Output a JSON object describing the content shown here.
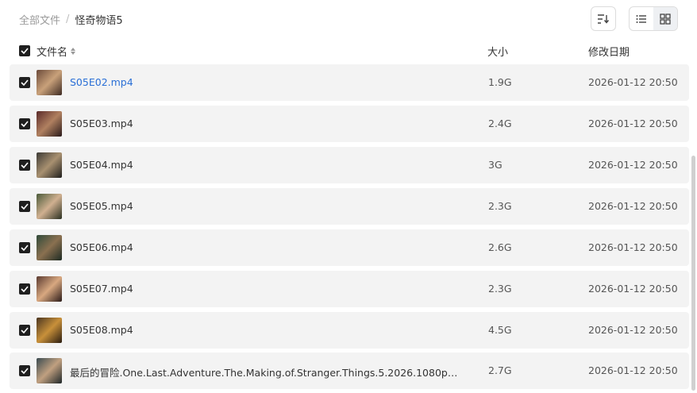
{
  "breadcrumb": {
    "root": "全部文件",
    "separator": "/",
    "current": "怪奇物语5"
  },
  "toolbar": {
    "sort_icon": "sort-icon",
    "list_view_icon": "list-view-icon",
    "grid_view_icon": "grid-view-icon",
    "active_view": "list"
  },
  "header": {
    "name": "文件名",
    "size": "大小",
    "date": "修改日期"
  },
  "files": [
    {
      "name": "S05E02.mp4",
      "size": "1.9G",
      "date": "2026-01-12 20:50",
      "highlight": true
    },
    {
      "name": "S05E03.mp4",
      "size": "2.4G",
      "date": "2026-01-12 20:50"
    },
    {
      "name": "S05E04.mp4",
      "size": "3G",
      "date": "2026-01-12 20:50"
    },
    {
      "name": "S05E05.mp4",
      "size": "2.3G",
      "date": "2026-01-12 20:50"
    },
    {
      "name": "S05E06.mp4",
      "size": "2.6G",
      "date": "2026-01-12 20:50"
    },
    {
      "name": "S05E07.mp4",
      "size": "2.3G",
      "date": "2026-01-12 20:50"
    },
    {
      "name": "S05E08.mp4",
      "size": "4.5G",
      "date": "2026-01-12 20:50"
    },
    {
      "name": "最后的冒险.One.Last.Adventure.The.Making.of.Stranger.Things.5.2026.1080p中英字...",
      "size": "2.7G",
      "date": "2026-01-12 20:50"
    }
  ],
  "colors": {
    "link": "#2a6fd6",
    "row_bg": "#f3f3f3",
    "checkbox": "#1f1f1f"
  }
}
